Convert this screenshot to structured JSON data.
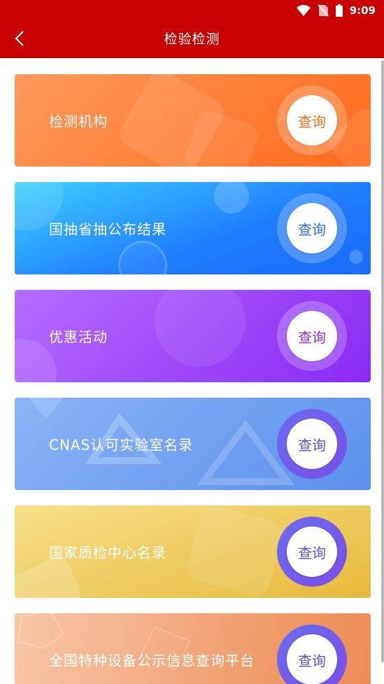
{
  "status_bar": {
    "time": "9:09"
  },
  "header": {
    "title": "检验检测"
  },
  "colors": {
    "header": "#c80000"
  },
  "cards": [
    {
      "label": "检测机构",
      "button": "查询",
      "button_color": "#ff6a1e"
    },
    {
      "label": "国抽省抽公布结果",
      "button": "查询",
      "button_color": "#2a6ff0"
    },
    {
      "label": "优惠活动",
      "button": "查询",
      "button_color": "#8f2cf0"
    },
    {
      "label": "CNAS认可实验室名录",
      "button": "查询",
      "button_color": "#5b4fd6"
    },
    {
      "label": "国家质检中心名录",
      "button": "查询",
      "button_color": "#5b4fd6"
    },
    {
      "label": "全国特种设备公示信息查询平台",
      "button": "查询",
      "button_color": "#5b4fd6"
    }
  ]
}
